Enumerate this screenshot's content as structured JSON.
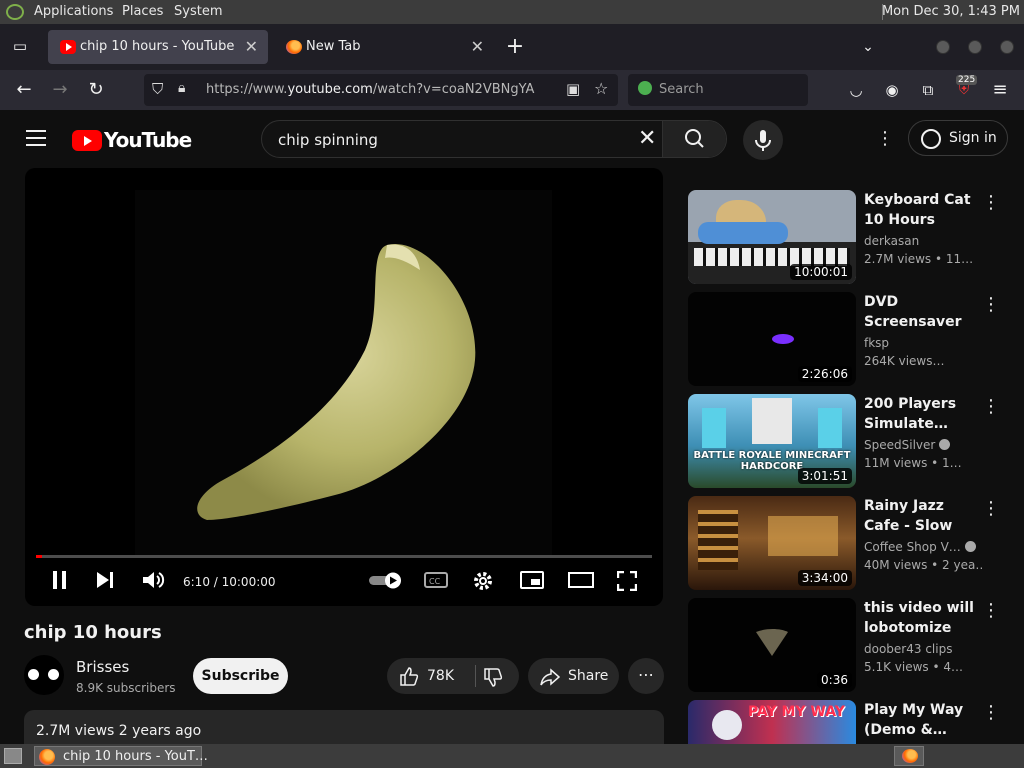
{
  "system": {
    "menu": [
      "Applications",
      "Places",
      "System"
    ],
    "clock": "Mon Dec 30,  1:43 PM"
  },
  "browser": {
    "tabs": [
      {
        "title": "chip 10 hours - YouTube",
        "active": true
      },
      {
        "title": "New Tab",
        "active": false
      }
    ],
    "url_prefix": "https://www.",
    "url_domain": "youtube.com",
    "url_path": "/watch?v=coaN2VBNgYA",
    "search_placeholder": "Search",
    "extension_badge": "225"
  },
  "youtube": {
    "logo_text": "YouTube",
    "search_query": "chip spinning",
    "sign_in": "Sign in",
    "player": {
      "time": "6:10 / 10:00:00",
      "progress": 0.0103
    },
    "video": {
      "title": "chip 10 hours",
      "channel": "Brisses",
      "subscribers": "8.9K subscribers",
      "subscribe": "Subscribe",
      "likes": "78K",
      "share": "Share",
      "views_date": "2.7M views  2 years ago"
    },
    "recommendations": [
      {
        "title": "Keyboard Cat 10 Hours",
        "channel": "derkasan",
        "views": "2.7M views  • 11…",
        "duration": "10:00:01",
        "verified": false
      },
      {
        "title": "DVD Screensaver test",
        "channel": "fksp",
        "views": "264K views…",
        "duration": "2:26:06",
        "verified": false
      },
      {
        "title": "200 Players Simulate…",
        "channel": "SpeedSilver",
        "views": "11M views  • 1…",
        "duration": "3:01:51",
        "verified": true,
        "thumb_text": "BATTLE ROYALE MINECRAFT HARDCORE"
      },
      {
        "title": "Rainy Jazz Cafe - Slow Jazz Musi…",
        "channel": "Coffee Shop V…",
        "views": "40M views  • 2 yea…",
        "duration": "3:34:00",
        "verified": true
      },
      {
        "title": "this video will lobotomize you…",
        "channel": "doober43 clips",
        "views": "5.1K views  • 4…",
        "duration": "0:36",
        "verified": false
      },
      {
        "title": "Play My Way (Demo &…",
        "channel": "",
        "views": "",
        "duration": "",
        "verified": false,
        "thumb_text": "PAY MY WAY"
      }
    ]
  },
  "taskbar": {
    "item": "chip 10 hours - YouT…"
  }
}
